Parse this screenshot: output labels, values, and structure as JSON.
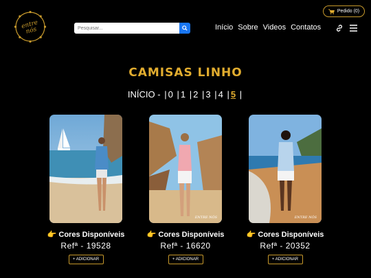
{
  "header": {
    "logo_text": "entre nós",
    "search_placeholder": "Pesquisar...",
    "nav": [
      "Início",
      "Sobre",
      "Videos",
      "Contatos"
    ],
    "order_label": "Pedido (0)"
  },
  "page_title": "CAMISAS LINHO",
  "pager": {
    "label": "INÍCIO -",
    "pages": [
      "0",
      "1",
      "2",
      "3",
      "4",
      "5"
    ],
    "current": "5"
  },
  "products": [
    {
      "colors_label": "Cores Disponíveis",
      "ref": "Refª - 19528",
      "add_label": "+ ADICIONAR",
      "watermark": ""
    },
    {
      "colors_label": "Cores Disponíveis",
      "ref": "Refª - 16620",
      "add_label": "+ ADICIONAR",
      "watermark": "ENTRE NÓS"
    },
    {
      "colors_label": "Cores Disponíveis",
      "ref": "Refª - 20352",
      "add_label": "+ ADICIONAR",
      "watermark": "ENTRE NÓS"
    }
  ],
  "colors": {
    "accent": "#e2ad2f",
    "search_button": "#1976f2",
    "background": "#000000"
  }
}
